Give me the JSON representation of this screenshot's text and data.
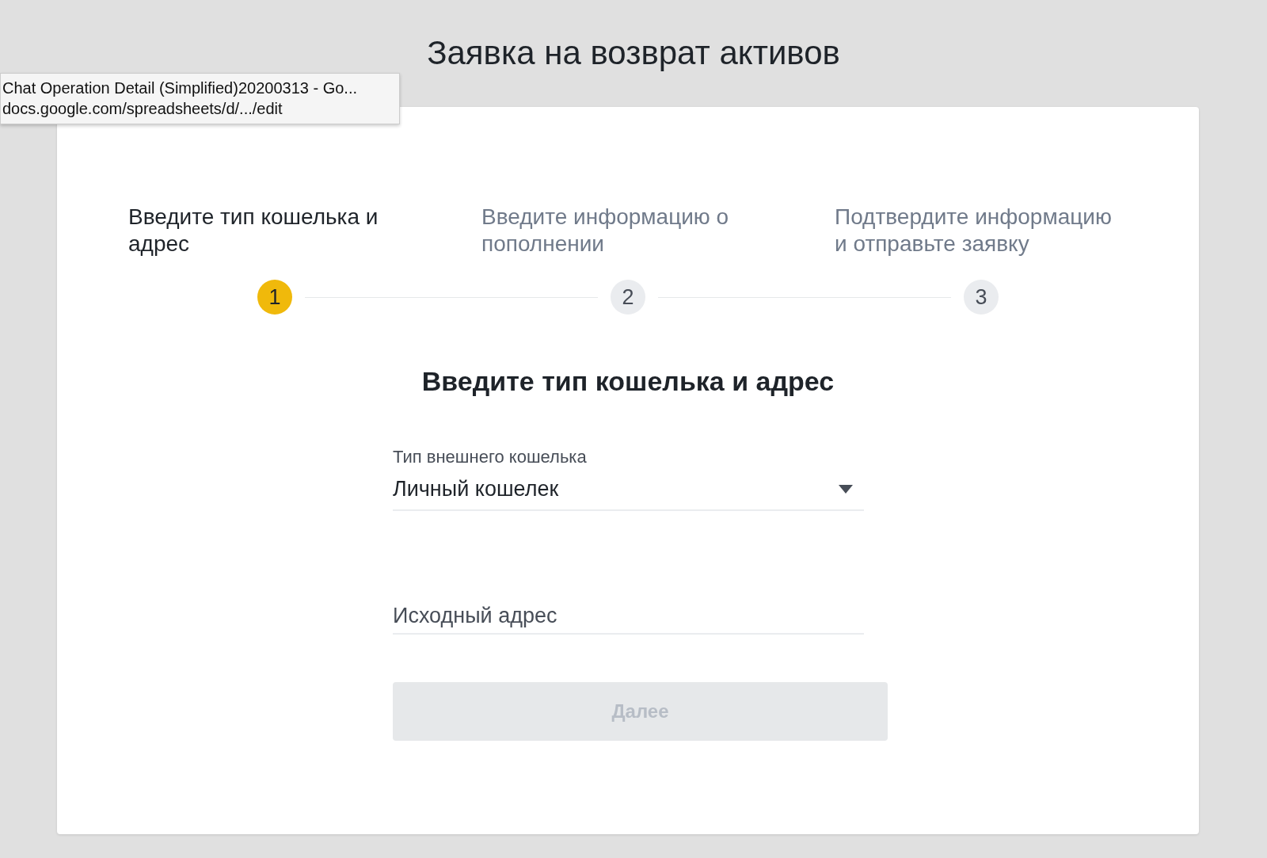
{
  "page_title": "Заявка на возврат активов",
  "tooltip": {
    "title": "Chat Operation Detail (Simplified)20200313 - Go...",
    "url": "docs.google.com/spreadsheets/d/.../edit"
  },
  "steps": [
    {
      "label": "Введите тип кошелька и адрес",
      "number": "1",
      "selected": true
    },
    {
      "label": "Введите информацию о пополнении",
      "number": "2",
      "selected": false
    },
    {
      "label": "Подтвердите информацию и отправьте заявку",
      "number": "3",
      "selected": false
    }
  ],
  "form": {
    "heading": "Введите тип кошелька и адрес",
    "wallet_type": {
      "label": "Тип внешнего кошелька",
      "value": "Личный кошелек"
    },
    "address": {
      "placeholder": "Исходный адрес"
    },
    "next_button": {
      "label": "Далее",
      "disabled": true
    }
  }
}
